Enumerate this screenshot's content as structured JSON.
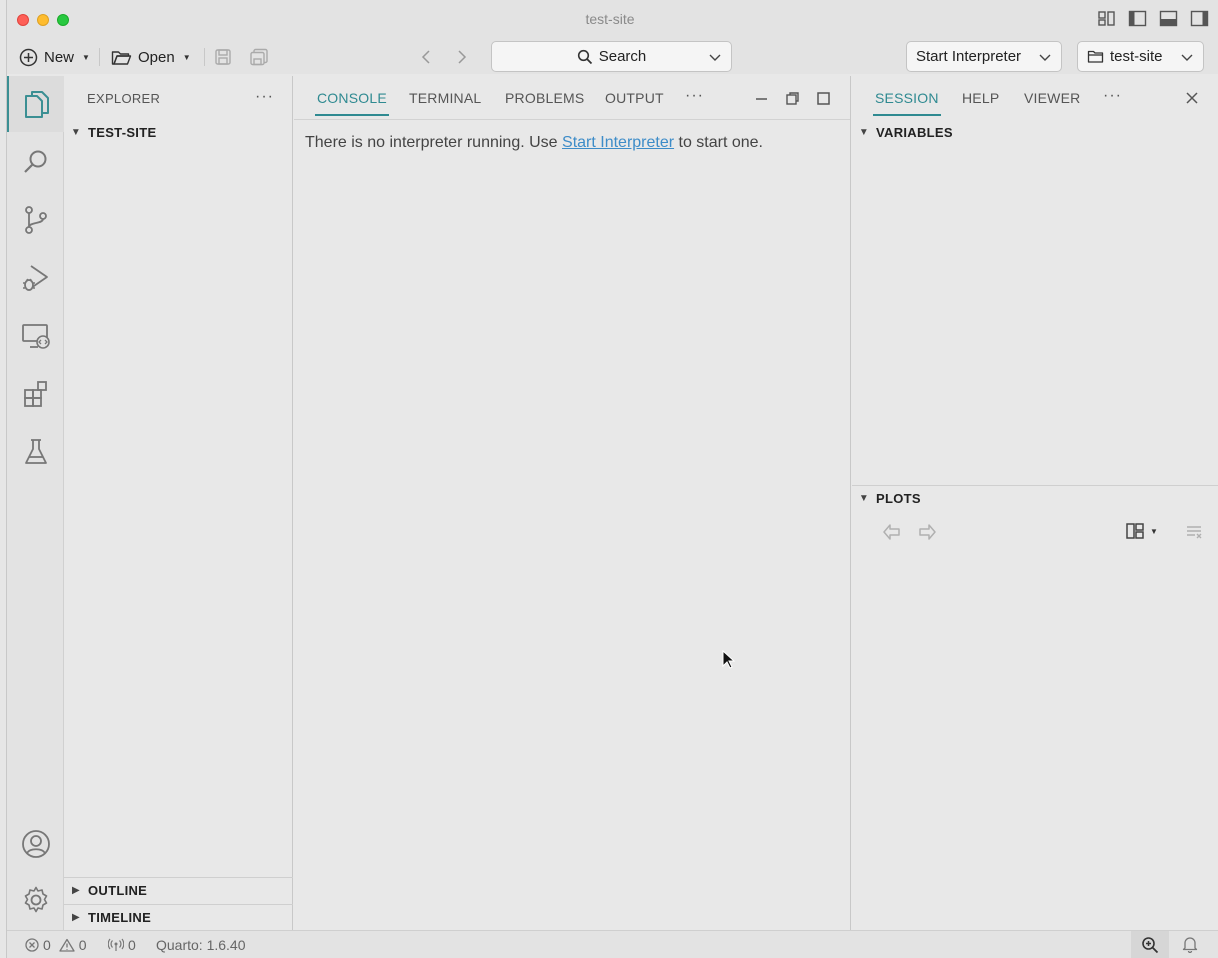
{
  "window": {
    "title": "test-site"
  },
  "toolbar": {
    "new_label": "New",
    "open_label": "Open",
    "search_label": "Search",
    "interpreter_label": "Start Interpreter",
    "folder_label": "test-site"
  },
  "activity_bar": {
    "items": [
      "files-icon",
      "search-icon",
      "source-control-icon",
      "run-debug-icon",
      "remote-explorer-icon",
      "extensions-icon",
      "testing-icon"
    ],
    "bottom": [
      "account-icon",
      "settings-icon"
    ]
  },
  "explorer": {
    "title": "EXPLORER",
    "root": "TEST-SITE",
    "outline": "OUTLINE",
    "timeline": "TIMELINE"
  },
  "console": {
    "tabs": [
      "CONSOLE",
      "TERMINAL",
      "PROBLEMS",
      "OUTPUT"
    ],
    "active_tab": "CONSOLE",
    "message_before": "There is no interpreter running. Use ",
    "message_link": "Start Interpreter",
    "message_after": " to start one."
  },
  "session": {
    "tabs": [
      "SESSION",
      "HELP",
      "VIEWER"
    ],
    "active_tab": "SESSION",
    "variables": "VARIABLES",
    "plots": "PLOTS"
  },
  "statusbar": {
    "errors": "0",
    "warnings": "0",
    "ports": "0",
    "quarto": "Quarto: 1.6.40"
  },
  "colors": {
    "accent": "#2f8a91",
    "link": "#3d8cc8"
  }
}
